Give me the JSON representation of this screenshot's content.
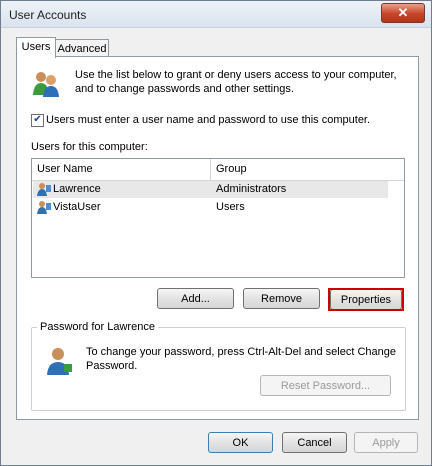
{
  "window": {
    "title": "User Accounts",
    "close_symbol": "✕"
  },
  "tabs": [
    {
      "label": "Users",
      "active": true
    },
    {
      "label": "Advanced",
      "active": false
    }
  ],
  "intro": {
    "line1": "Use the list below to grant or deny users access to your computer,",
    "line2": "and to change passwords and other settings."
  },
  "checkbox": {
    "checked": true,
    "label": "Users must enter a user name and password to use this computer."
  },
  "users_section_label": "Users for this computer:",
  "table": {
    "columns": [
      "User Name",
      "Group"
    ],
    "rows": [
      {
        "name": "Lawrence",
        "group": "Administrators",
        "selected": true
      },
      {
        "name": "VistaUser",
        "group": "Users",
        "selected": false
      }
    ]
  },
  "buttons": {
    "add": "Add...",
    "remove": "Remove",
    "properties": "Properties"
  },
  "password_group": {
    "title": "Password for Lawrence",
    "line1": "To change your password, press Ctrl-Alt-Del and select Change",
    "line2": "Password.",
    "reset_button": "Reset Password..."
  },
  "footer": {
    "ok": "OK",
    "cancel": "Cancel",
    "apply": "Apply"
  },
  "colors": {
    "highlight": "#cc0000",
    "close_button": "#c6452a"
  }
}
